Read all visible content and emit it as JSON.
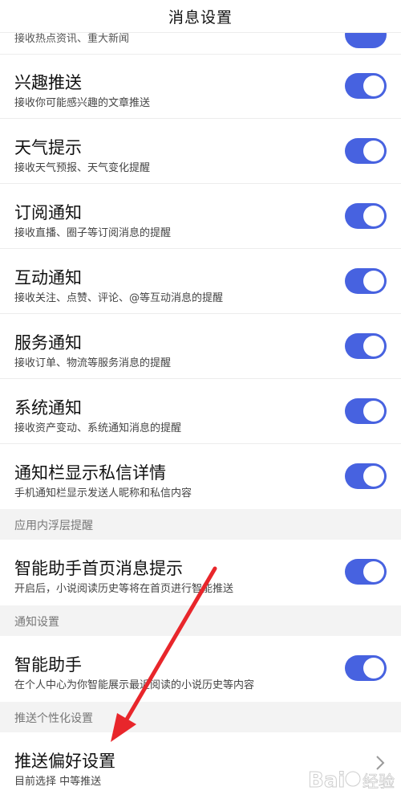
{
  "header": {
    "title": "消息设置"
  },
  "partial_row": {
    "subtitle": "接收热点资讯、重大新闻"
  },
  "rows": [
    {
      "title": "兴趣推送",
      "subtitle": "接收你可能感兴趣的文章推送",
      "toggle_on": true
    },
    {
      "title": "天气提示",
      "subtitle": "接收天气预报、天气变化提醒",
      "toggle_on": true
    },
    {
      "title": "订阅通知",
      "subtitle": "接收直播、圈子等订阅消息的提醒",
      "toggle_on": true
    },
    {
      "title": "互动通知",
      "subtitle": "接收关注、点赞、评论、@等互动消息的提醒",
      "toggle_on": true
    },
    {
      "title": "服务通知",
      "subtitle": "接收订单、物流等服务消息的提醒",
      "toggle_on": true
    },
    {
      "title": "系统通知",
      "subtitle": "接收资产变动、系统通知消息的提醒",
      "toggle_on": true
    },
    {
      "title": "通知栏显示私信详情",
      "subtitle": "手机通知栏显示发送人昵称和私信内容",
      "toggle_on": true
    }
  ],
  "sections": {
    "in_app": "应用内浮层提醒",
    "notify": "通知设置",
    "push_personal": "推送个性化设置"
  },
  "assistant_home": {
    "title": "智能助手首页消息提示",
    "subtitle": "开启后，小说阅读历史等将在首页进行智能推送",
    "toggle_on": true
  },
  "assistant": {
    "title": "智能助手",
    "subtitle": "在个人中心为你智能展示最近阅读的小说历史等内容",
    "toggle_on": true
  },
  "push_pref": {
    "title": "推送偏好设置",
    "subtitle": "目前选择 中等推送"
  },
  "colors": {
    "accent": "#4762e0",
    "annotation_arrow": "#e8262b",
    "section_bg": "#f3f3f3"
  },
  "watermark": {
    "text": "Bai 经验"
  }
}
